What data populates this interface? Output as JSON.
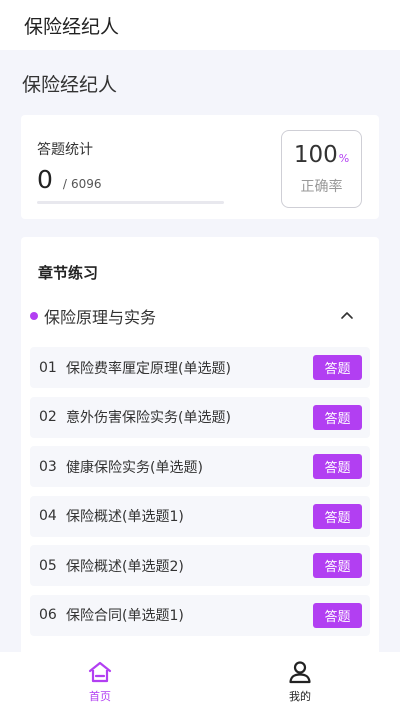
{
  "topbar": {
    "title": "保险经纪人"
  },
  "page": {
    "heading": "保险经纪人"
  },
  "stats": {
    "label": "答题统计",
    "answered": "0",
    "separator": "/",
    "total": "6096",
    "progress": 0,
    "accuracy_value": "100",
    "accuracy_unit": "%",
    "accuracy_label": "正确率"
  },
  "chapter": {
    "title": "章节练习",
    "section_name": "保险原理与实务",
    "questions": [
      {
        "num": "01",
        "name": "保险费率厘定原理(单选题)",
        "button": "答题"
      },
      {
        "num": "02",
        "name": "意外伤害保险实务(单选题)",
        "button": "答题"
      },
      {
        "num": "03",
        "name": "健康保险实务(单选题)",
        "button": "答题"
      },
      {
        "num": "04",
        "name": "保险概述(单选题1)",
        "button": "答题"
      },
      {
        "num": "05",
        "name": "保险概述(单选题2)",
        "button": "答题"
      },
      {
        "num": "06",
        "name": "保险合同(单选题1)",
        "button": "答题"
      }
    ]
  },
  "tabbar": {
    "home_label": "首页",
    "mine_label": "我的"
  },
  "colors": {
    "accent": "#b23ff2",
    "background": "#f4f5fb"
  }
}
